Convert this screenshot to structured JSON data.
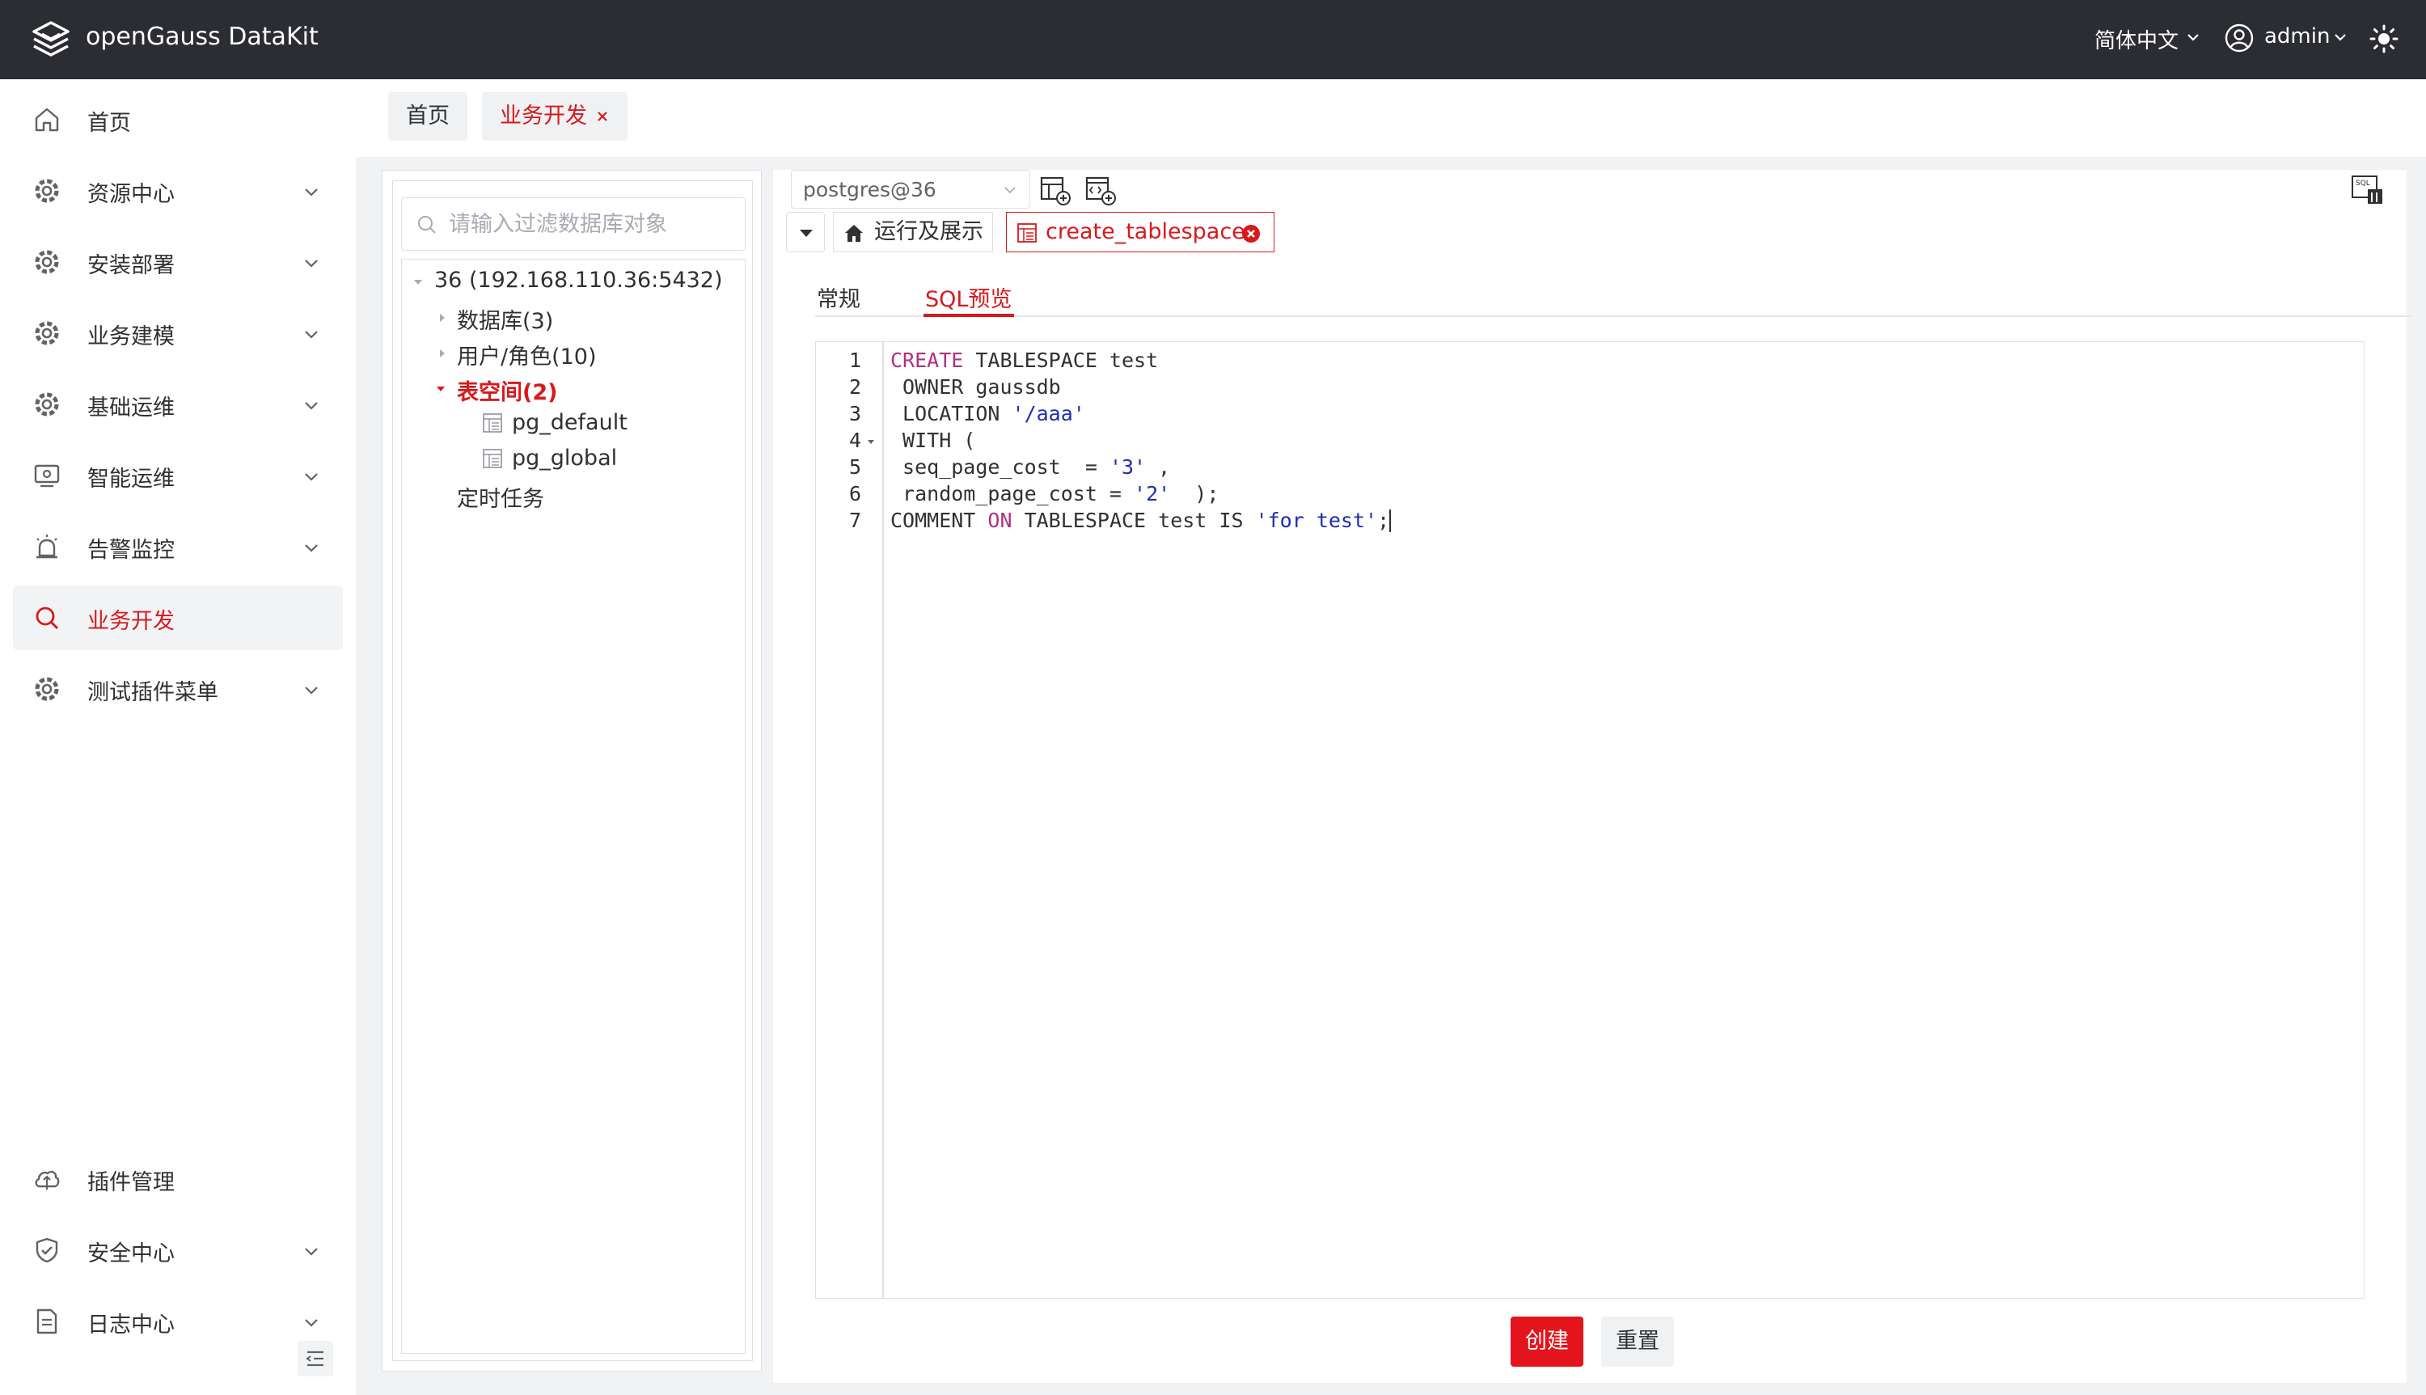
{
  "header": {
    "app_title": "openGauss DataKit",
    "language": "简体中文",
    "user": "admin"
  },
  "sidebar": {
    "items": [
      {
        "label": "首页",
        "icon": "home-icon"
      },
      {
        "label": "资源中心",
        "icon": "gear-icon"
      },
      {
        "label": "安装部署",
        "icon": "gear-icon"
      },
      {
        "label": "业务建模",
        "icon": "gear-icon"
      },
      {
        "label": "基础运维",
        "icon": "gear-icon"
      },
      {
        "label": "智能运维",
        "icon": "monitor-icon"
      },
      {
        "label": "告警监控",
        "icon": "alarm-icon"
      },
      {
        "label": "业务开发",
        "icon": "search-icon",
        "active": true
      },
      {
        "label": "测试插件菜单",
        "icon": "gear-icon"
      },
      {
        "label": "插件管理",
        "icon": "cloud-icon"
      },
      {
        "label": "安全中心",
        "icon": "shield-icon"
      },
      {
        "label": "日志中心",
        "icon": "document-icon"
      }
    ]
  },
  "page_tabs": {
    "home": "首页",
    "dev": "业务开发"
  },
  "tree": {
    "filter_placeholder": "请输入过滤数据库对象",
    "root": "36 (192.168.110.36:5432)",
    "databases": "数据库(3)",
    "users_roles": "用户/角色(10)",
    "tablespaces": "表空间(2)",
    "ts_default": "pg_default",
    "ts_global": "pg_global",
    "scheduled_tasks": "定时任务"
  },
  "editor_panel": {
    "connection": "postgres@36",
    "run_tab": "运行及展示",
    "query_tab": "create_tablespace",
    "subtab_general": "常规",
    "subtab_sql": "SQL预览",
    "line_numbers": [
      "1",
      "2",
      "3",
      "4",
      "5",
      "6",
      "7"
    ],
    "create_button": "创建",
    "reset_button": "重置"
  },
  "colors": {
    "brand_red": "#d7191d",
    "header_bg": "#2b2d33",
    "keyword": "#b0317f",
    "string": "#1f2db3"
  }
}
